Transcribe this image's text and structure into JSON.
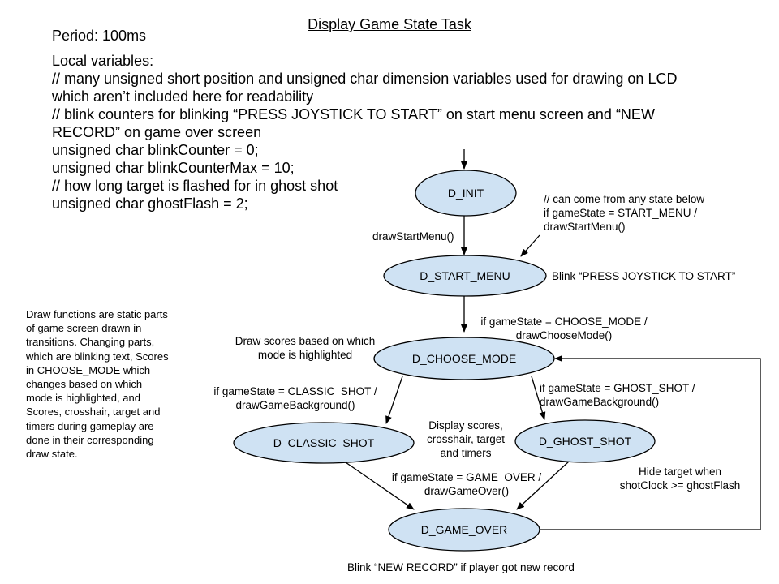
{
  "title": "Display Game State Task",
  "period": "Period: 100ms",
  "local_variables": [
    "Local variables:",
    "// many unsigned short position and unsigned char dimension variables used for drawing on LCD",
    "which aren’t included here for readability",
    "// blink counters for blinking “PRESS JOYSTICK TO START” on start menu screen and “NEW",
    "RECORD” on game over screen",
    "unsigned char blinkCounter = 0;",
    "unsigned char blinkCounterMax = 10;",
    "// how long target is flashed for in ghost shot",
    "unsigned char ghostFlash = 2;"
  ],
  "side_note": [
    "Draw functions are static parts",
    "of game screen drawn in",
    "transitions. Changing parts,",
    "which are blinking text, Scores",
    "in CHOOSE_MODE which",
    "changes based on which",
    "mode is highlighted, and",
    "Scores, crosshair, target and",
    "timers during gameplay are",
    "done in their corresponding",
    "draw state."
  ],
  "states": {
    "init": "D_INIT",
    "start_menu": "D_START_MENU",
    "choose_mode": "D_CHOOSE_MODE",
    "classic_shot": "D_CLASSIC_SHOT",
    "ghost_shot": "D_GHOST_SHOT",
    "game_over": "D_GAME_OVER"
  },
  "transitions": {
    "init_to_start": "drawStartMenu()",
    "any_to_start": [
      "// can come from any state below",
      "if gameState = START_MENU /",
      "drawStartMenu()"
    ],
    "start_to_choose": [
      "if gameState = CHOOSE_MODE /",
      "drawChooseMode()"
    ],
    "choose_to_classic": [
      "if gameState = CLASSIC_SHOT /",
      "drawGameBackground()"
    ],
    "choose_to_ghost": [
      "if gameState = GHOST_SHOT /",
      "drawGameBackground()"
    ],
    "to_game_over": [
      "if gameState = GAME_OVER /",
      "drawGameOver()"
    ]
  },
  "state_actions": {
    "start_menu": "Blink “PRESS JOYSTICK TO START”",
    "choose_mode": [
      "Draw scores based on which",
      "mode is highlighted"
    ],
    "gameplay": [
      "Display scores,",
      "crosshair, target",
      "and timers"
    ],
    "ghost_shot": [
      "Hide target when",
      "shotClock >= ghostFlash"
    ],
    "game_over": "Blink “NEW RECORD” if player got new record"
  },
  "colors": {
    "state_fill": "#cfe2f3",
    "stroke": "#000000"
  }
}
